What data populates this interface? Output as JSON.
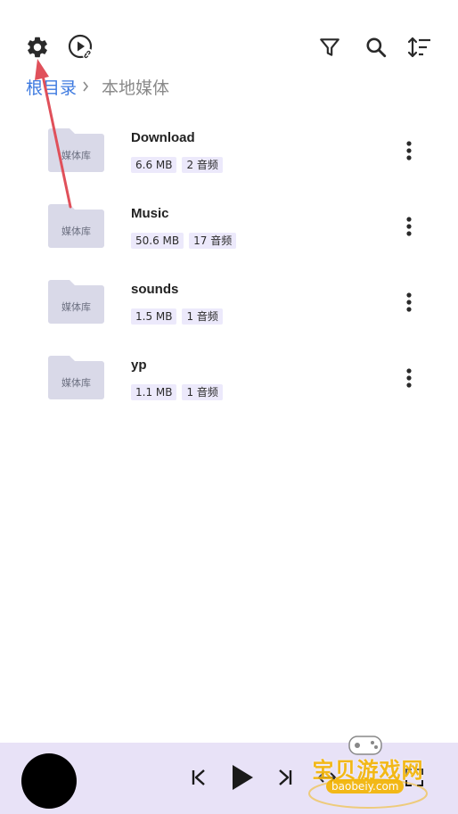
{
  "toolbar": {
    "icons": [
      "gear-icon",
      "play-circle-link-icon",
      "filter-icon",
      "search-icon",
      "sort-icon"
    ]
  },
  "breadcrumb": {
    "root": "根目录",
    "current": "本地媒体"
  },
  "items": [
    {
      "name": "Download",
      "folder_label": "媒体库",
      "size": "6.6 MB",
      "count": "2 音频"
    },
    {
      "name": "Music",
      "folder_label": "媒体库",
      "size": "50.6 MB",
      "count": "17 音频"
    },
    {
      "name": "sounds",
      "folder_label": "媒体库",
      "size": "1.5 MB",
      "count": "1 音频"
    },
    {
      "name": "yp",
      "folder_label": "媒体库",
      "size": "1.1 MB",
      "count": "1 音频"
    }
  ],
  "player": {
    "icons": [
      "previous-icon",
      "play-icon",
      "next-icon",
      "shuffle-icon",
      "fullscreen-icon"
    ]
  },
  "watermark": {
    "title": "宝贝游戏网",
    "site": "baobeiy.com"
  },
  "colors": {
    "accent": "#3f7be0",
    "badge_bg": "#ece9fb",
    "player_bg": "#e8e2f7",
    "folder": "#d9d9e8",
    "annotation": "#e0505a"
  }
}
